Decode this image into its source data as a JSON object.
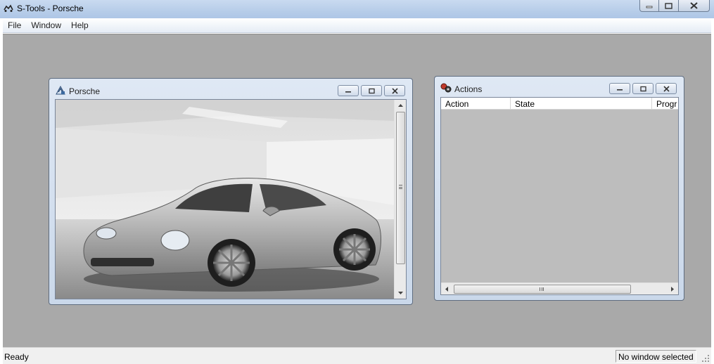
{
  "app": {
    "title": "S-Tools - Porsche"
  },
  "menu": {
    "items": [
      "File",
      "Window",
      "Help"
    ]
  },
  "status": {
    "left": "Ready",
    "right": "No window selected"
  },
  "porsche_window": {
    "title": "Porsche",
    "image": "silver Porsche 911 coupe in grey studio"
  },
  "actions_window": {
    "title": "Actions",
    "columns": [
      "Action",
      "State",
      "Progr"
    ]
  },
  "icons": {
    "app": "stools-app-icon",
    "porsche": "picture-icon",
    "actions": "actions-icon"
  },
  "colors": {
    "titlebar": "#b7cde9",
    "mdi_background": "#a9a9a9",
    "list_background": "#bdbdbd"
  }
}
